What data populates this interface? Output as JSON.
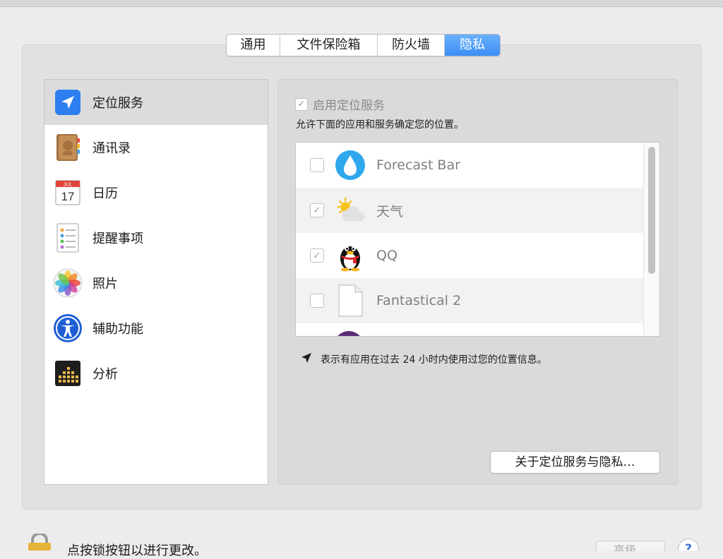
{
  "tabs": [
    {
      "label": "通用",
      "selected": false
    },
    {
      "label": "文件保险箱",
      "selected": false
    },
    {
      "label": "防火墙",
      "selected": false
    },
    {
      "label": "隐私",
      "selected": true
    }
  ],
  "sidebar": {
    "items": [
      {
        "label": "定位服务",
        "icon": "location-arrow-icon",
        "selected": true
      },
      {
        "label": "通讯录",
        "icon": "contacts-book-icon"
      },
      {
        "label": "日历",
        "icon": "calendar-icon",
        "icon_month": "JUL",
        "icon_day": "17"
      },
      {
        "label": "提醒事项",
        "icon": "reminders-list-icon"
      },
      {
        "label": "照片",
        "icon": "photos-flower-icon"
      },
      {
        "label": "辅助功能",
        "icon": "accessibility-person-icon"
      },
      {
        "label": "分析",
        "icon": "analytics-grid-icon"
      }
    ]
  },
  "location": {
    "enable_label": "启用定位服务",
    "enable_checked": true,
    "description": "允许下面的应用和服务确定您的位置。",
    "apps": [
      {
        "name": "Forecast Bar",
        "checked": false,
        "icon": "raindrop-icon"
      },
      {
        "name": "天气",
        "checked": true,
        "icon": "sun-cloud-icon"
      },
      {
        "name": "QQ",
        "checked": true,
        "icon": "penguin-icon"
      },
      {
        "name": "Fantastical 2",
        "checked": false,
        "icon": "blank-document-icon"
      }
    ],
    "legend_text": "表示有应用在过去 24 小时内使用过您的位置信息。",
    "about_button": "关于定位服务与隐私…"
  },
  "footer": {
    "lock_text": "点按锁按钮以进行更改。",
    "advanced_button": "高级…",
    "help_label": "?"
  },
  "colors": {
    "accent": "#3b8ef5",
    "selected_row": "#dcdcdc",
    "background": "#ececec"
  }
}
